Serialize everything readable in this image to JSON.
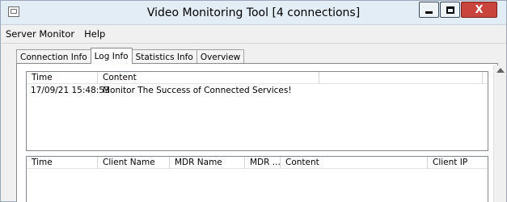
{
  "window": {
    "title": "Video Monitoring Tool [4 connections]",
    "icon": "app-window-icon",
    "close_glyph": "X"
  },
  "menu": {
    "items": [
      "Server Monitor",
      "Help"
    ]
  },
  "tabs": [
    {
      "label": "Connection Info",
      "active": false
    },
    {
      "label": "Log Info",
      "active": true
    },
    {
      "label": "Statistics Info",
      "active": false
    },
    {
      "label": "Overview",
      "active": false
    }
  ],
  "log_list": {
    "columns": [
      "Time",
      "Content",
      ""
    ],
    "rows": [
      {
        "time": "17/09/21 15:48:53",
        "content": "Monitor The Success of Connected Services!"
      }
    ]
  },
  "client_list": {
    "columns": [
      "Time",
      "Client Name",
      "MDR Name",
      "MDR ...",
      "Content",
      "Client IP"
    ],
    "rows": []
  },
  "colors": {
    "titlebar": "#e3edf6",
    "close_button": "#c8443c",
    "window_bg": "#f0f0f0"
  }
}
